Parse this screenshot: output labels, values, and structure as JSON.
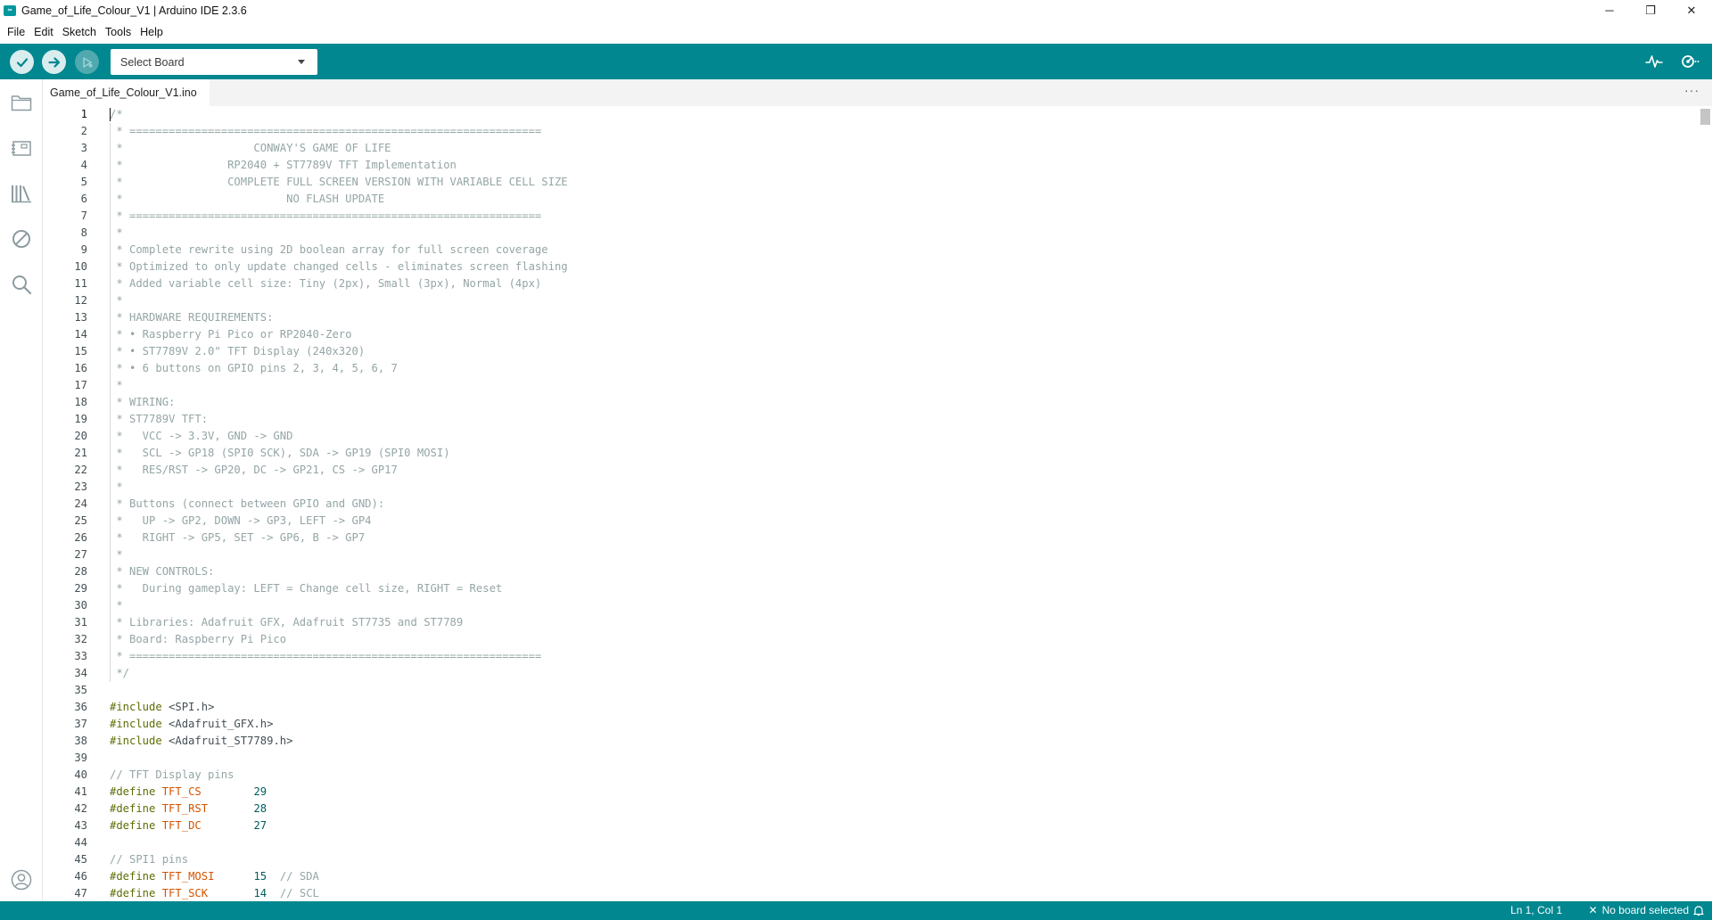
{
  "window": {
    "icon_text": "∞",
    "title": "Game_of_Life_Colour_V1 | Arduino IDE 2.3.6",
    "minimize": "─",
    "maximize": "❐",
    "close": "✕"
  },
  "menu": [
    "File",
    "Edit",
    "Sketch",
    "Tools",
    "Help"
  ],
  "toolbar": {
    "board_placeholder": "Select Board",
    "icons": [
      "verify-icon",
      "upload-icon",
      "debug-icon",
      "serial-plotter-icon",
      "serial-monitor-icon"
    ]
  },
  "sidebar": {
    "icons": [
      "folder-icon",
      "board-manager-icon",
      "library-manager-icon",
      "debug-disabled-icon",
      "search-icon",
      "account-icon"
    ]
  },
  "tab": {
    "filename": "Game_of_Life_Colour_V1.ino",
    "more": "···"
  },
  "editor": {
    "active_line": 1,
    "lines": [
      [
        [
          "comment",
          "/*"
        ]
      ],
      [
        [
          "comment",
          " * ==============================================================="
        ]
      ],
      [
        [
          "comment",
          " *                    CONWAY'S GAME OF LIFE"
        ]
      ],
      [
        [
          "comment",
          " *                RP2040 + ST7789V TFT Implementation"
        ]
      ],
      [
        [
          "comment",
          " *                COMPLETE FULL SCREEN VERSION WITH VARIABLE CELL SIZE"
        ]
      ],
      [
        [
          "comment",
          " *                         NO FLASH UPDATE"
        ]
      ],
      [
        [
          "comment",
          " * ==============================================================="
        ]
      ],
      [
        [
          "comment",
          " *"
        ]
      ],
      [
        [
          "comment",
          " * Complete rewrite using 2D boolean array for full screen coverage"
        ]
      ],
      [
        [
          "comment",
          " * Optimized to only update changed cells - eliminates screen flashing"
        ]
      ],
      [
        [
          "comment",
          " * Added variable cell size: Tiny (2px), Small (3px), Normal (4px)"
        ]
      ],
      [
        [
          "comment",
          " *"
        ]
      ],
      [
        [
          "comment",
          " * HARDWARE REQUIREMENTS:"
        ]
      ],
      [
        [
          "comment",
          " * • Raspberry Pi Pico or RP2040-Zero"
        ]
      ],
      [
        [
          "comment",
          " * • ST7789V 2.0\" TFT Display (240x320)"
        ]
      ],
      [
        [
          "comment",
          " * • 6 buttons on GPIO pins 2, 3, 4, 5, 6, 7"
        ]
      ],
      [
        [
          "comment",
          " *"
        ]
      ],
      [
        [
          "comment",
          " * WIRING:"
        ]
      ],
      [
        [
          "comment",
          " * ST7789V TFT:"
        ]
      ],
      [
        [
          "comment",
          " *   VCC -> 3.3V, GND -> GND"
        ]
      ],
      [
        [
          "comment",
          " *   SCL -> GP18 (SPI0 SCK), SDA -> GP19 (SPI0 MOSI)"
        ]
      ],
      [
        [
          "comment",
          " *   RES/RST -> GP20, DC -> GP21, CS -> GP17"
        ]
      ],
      [
        [
          "comment",
          " *"
        ]
      ],
      [
        [
          "comment",
          " * Buttons (connect between GPIO and GND):"
        ]
      ],
      [
        [
          "comment",
          " *   UP -> GP2, DOWN -> GP3, LEFT -> GP4"
        ]
      ],
      [
        [
          "comment",
          " *   RIGHT -> GP5, SET -> GP6, B -> GP7"
        ]
      ],
      [
        [
          "comment",
          " *"
        ]
      ],
      [
        [
          "comment",
          " * NEW CONTROLS:"
        ]
      ],
      [
        [
          "comment",
          " *   During gameplay: LEFT = Change cell size, RIGHT = Reset"
        ]
      ],
      [
        [
          "comment",
          " *"
        ]
      ],
      [
        [
          "comment",
          " * Libraries: Adafruit GFX, Adafruit ST7735 and ST7789"
        ]
      ],
      [
        [
          "comment",
          " * Board: Raspberry Pi Pico"
        ]
      ],
      [
        [
          "comment",
          " * ==============================================================="
        ]
      ],
      [
        [
          "comment",
          " */"
        ]
      ],
      [],
      [
        [
          "directive",
          "#include"
        ],
        [
          "plain",
          " <SPI.h>"
        ]
      ],
      [
        [
          "directive",
          "#include"
        ],
        [
          "plain",
          " <Adafruit_GFX.h>"
        ]
      ],
      [
        [
          "directive",
          "#include"
        ],
        [
          "plain",
          " <Adafruit_ST7789.h>"
        ]
      ],
      [],
      [
        [
          "comment",
          "// TFT Display pins"
        ]
      ],
      [
        [
          "directive",
          "#define"
        ],
        [
          "plain",
          " "
        ],
        [
          "macro",
          "TFT_CS"
        ],
        [
          "plain",
          "        "
        ],
        [
          "number",
          "29"
        ]
      ],
      [
        [
          "directive",
          "#define"
        ],
        [
          "plain",
          " "
        ],
        [
          "macro",
          "TFT_RST"
        ],
        [
          "plain",
          "       "
        ],
        [
          "number",
          "28"
        ]
      ],
      [
        [
          "directive",
          "#define"
        ],
        [
          "plain",
          " "
        ],
        [
          "macro",
          "TFT_DC"
        ],
        [
          "plain",
          "        "
        ],
        [
          "number",
          "27"
        ]
      ],
      [],
      [
        [
          "comment",
          "// SPI1 pins"
        ]
      ],
      [
        [
          "directive",
          "#define"
        ],
        [
          "plain",
          " "
        ],
        [
          "macro",
          "TFT_MOSI"
        ],
        [
          "plain",
          "      "
        ],
        [
          "number",
          "15"
        ],
        [
          "plain",
          "  "
        ],
        [
          "comment",
          "// SDA"
        ]
      ],
      [
        [
          "directive",
          "#define"
        ],
        [
          "plain",
          " "
        ],
        [
          "macro",
          "TFT_SCK"
        ],
        [
          "plain",
          "       "
        ],
        [
          "number",
          "14"
        ],
        [
          "plain",
          "  "
        ],
        [
          "comment",
          "// SCL"
        ]
      ]
    ]
  },
  "status": {
    "position": "Ln 1, Col 1",
    "board_icon": "✕",
    "board": "No board selected"
  }
}
